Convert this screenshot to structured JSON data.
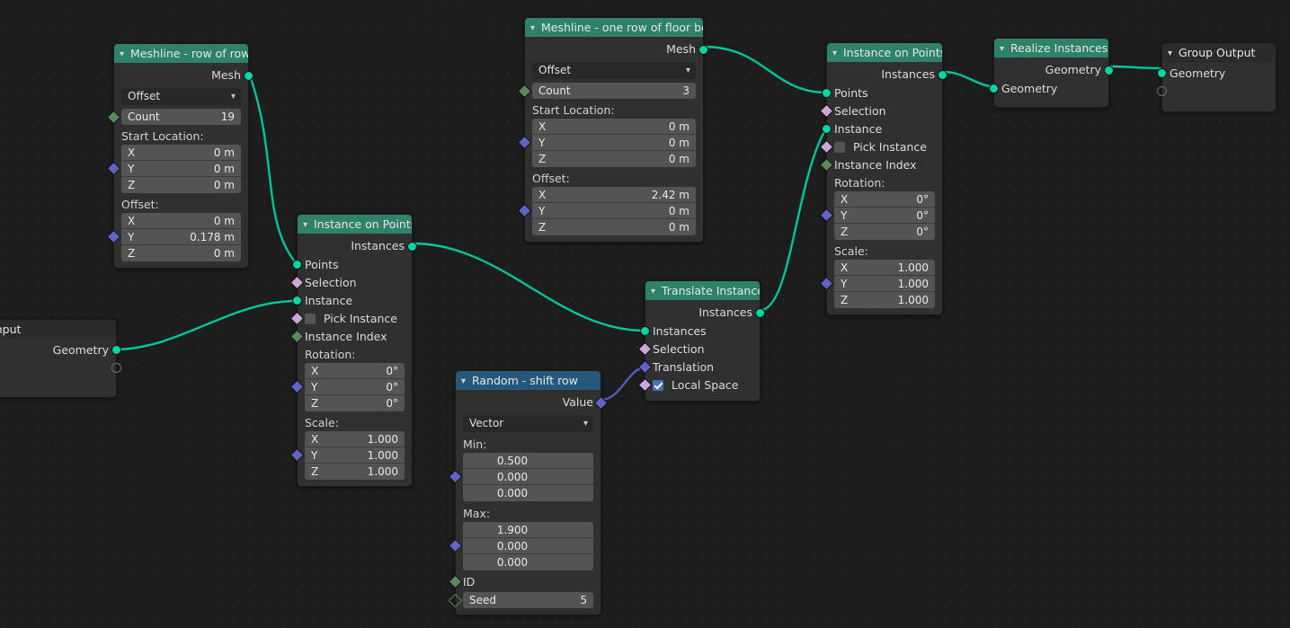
{
  "app": {
    "editor": "Blender Geometry Node Editor",
    "background": "#1d1d1d",
    "header_colors": {
      "geometry": "#2e8269",
      "input": "#24587d",
      "group": "#2b2b2b"
    },
    "socket_colors": {
      "geometry": "#00d6a3",
      "vector": "#6363c7",
      "boolean": "#cca6d6",
      "integer": "#598c5c",
      "float": "#a1a1a1"
    },
    "collapse_icon": "chevron-down-icon"
  },
  "nodes": {
    "group_input": {
      "title": "Group Input",
      "outputs": [
        {
          "label": "Geometry",
          "type": "geometry"
        }
      ],
      "new_socket": ""
    },
    "meshline_rows": {
      "title": "Meshline - row of rows",
      "outputs": [
        {
          "label": "Mesh",
          "type": "geometry"
        }
      ],
      "mode": "Offset",
      "count": {
        "label": "Count",
        "value": "19"
      },
      "start_location_label": "Start Location:",
      "start_location": [
        {
          "axis": "X",
          "value": "0 m"
        },
        {
          "axis": "Y",
          "value": "0 m"
        },
        {
          "axis": "Z",
          "value": "0 m"
        }
      ],
      "offset_label": "Offset:",
      "offset": [
        {
          "axis": "X",
          "value": "0 m"
        },
        {
          "axis": "Y",
          "value": "0.178 m"
        },
        {
          "axis": "Z",
          "value": "0 m"
        }
      ]
    },
    "meshline_boards": {
      "title": "Meshline - one row of floor boards",
      "outputs": [
        {
          "label": "Mesh",
          "type": "geometry"
        }
      ],
      "mode": "Offset",
      "count": {
        "label": "Count",
        "value": "3"
      },
      "start_location_label": "Start Location:",
      "start_location": [
        {
          "axis": "X",
          "value": "0 m"
        },
        {
          "axis": "Y",
          "value": "0 m"
        },
        {
          "axis": "Z",
          "value": "0 m"
        }
      ],
      "offset_label": "Offset:",
      "offset": [
        {
          "axis": "X",
          "value": "2.42 m"
        },
        {
          "axis": "Y",
          "value": "0 m"
        },
        {
          "axis": "Z",
          "value": "0 m"
        }
      ]
    },
    "iop_left": {
      "title": "Instance on Points",
      "outputs": [
        {
          "label": "Instances",
          "type": "geometry"
        }
      ],
      "inputs": [
        {
          "label": "Points",
          "type": "geometry"
        },
        {
          "label": "Selection",
          "type": "boolean"
        },
        {
          "label": "Instance",
          "type": "geometry"
        },
        {
          "label": "Pick Instance",
          "type": "boolean",
          "checked": false
        },
        {
          "label": "Instance Index",
          "type": "integer"
        }
      ],
      "rotation_label": "Rotation:",
      "rotation": [
        {
          "axis": "X",
          "value": "0°"
        },
        {
          "axis": "Y",
          "value": "0°"
        },
        {
          "axis": "Z",
          "value": "0°"
        }
      ],
      "scale_label": "Scale:",
      "scale": [
        {
          "axis": "X",
          "value": "1.000"
        },
        {
          "axis": "Y",
          "value": "1.000"
        },
        {
          "axis": "Z",
          "value": "1.000"
        }
      ]
    },
    "iop_right": {
      "title": "Instance on Points",
      "outputs": [
        {
          "label": "Instances",
          "type": "geometry"
        }
      ],
      "inputs": [
        {
          "label": "Points",
          "type": "geometry"
        },
        {
          "label": "Selection",
          "type": "boolean"
        },
        {
          "label": "Instance",
          "type": "geometry"
        },
        {
          "label": "Pick Instance",
          "type": "boolean",
          "checked": false
        },
        {
          "label": "Instance Index",
          "type": "integer"
        }
      ],
      "rotation_label": "Rotation:",
      "rotation": [
        {
          "axis": "X",
          "value": "0°"
        },
        {
          "axis": "Y",
          "value": "0°"
        },
        {
          "axis": "Z",
          "value": "0°"
        }
      ],
      "scale_label": "Scale:",
      "scale": [
        {
          "axis": "X",
          "value": "1.000"
        },
        {
          "axis": "Y",
          "value": "1.000"
        },
        {
          "axis": "Z",
          "value": "1.000"
        }
      ]
    },
    "translate_instances": {
      "title": "Translate Instances",
      "outputs": [
        {
          "label": "Instances",
          "type": "geometry"
        }
      ],
      "inputs": [
        {
          "label": "Instances",
          "type": "geometry"
        },
        {
          "label": "Selection",
          "type": "boolean"
        },
        {
          "label": "Translation",
          "type": "vector"
        },
        {
          "label": "Local Space",
          "type": "boolean",
          "checked": true
        }
      ]
    },
    "random_shift": {
      "title": "Random - shift row",
      "outputs": [
        {
          "label": "Value",
          "type": "vector"
        }
      ],
      "data_type": "Vector",
      "min_label": "Min:",
      "min": [
        "0.500",
        "0.000",
        "0.000"
      ],
      "max_label": "Max:",
      "max": [
        "1.900",
        "0.000",
        "0.000"
      ],
      "id_label": "ID",
      "seed": {
        "label": "Seed",
        "value": "5"
      }
    },
    "realize_instances": {
      "title": "Realize Instances",
      "outputs": [
        {
          "label": "Geometry",
          "type": "geometry"
        }
      ],
      "inputs": [
        {
          "label": "Geometry",
          "type": "geometry"
        }
      ]
    },
    "group_output": {
      "title": "Group Output",
      "inputs": [
        {
          "label": "Geometry",
          "type": "geometry"
        }
      ],
      "new_socket": ""
    }
  }
}
